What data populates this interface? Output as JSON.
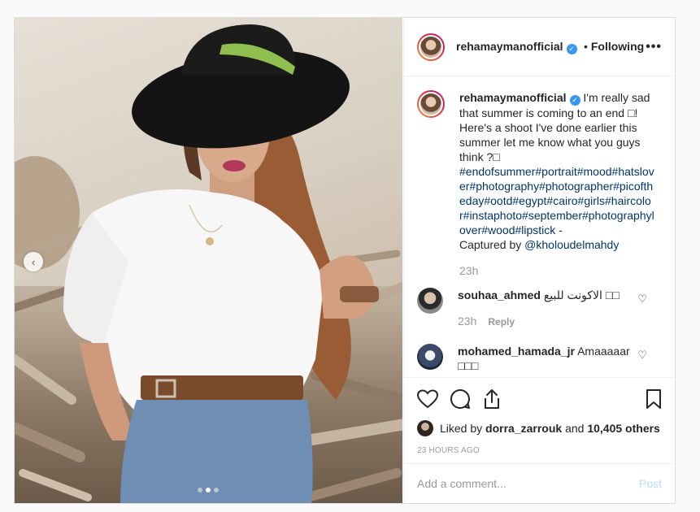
{
  "post": {
    "username": "rehamaymanofficial",
    "verified_mark": "✓",
    "separator": "•",
    "following_label": "Following",
    "more_label": "•••",
    "caption_text": "I'm really sad that summer is coming to an end □! Here's a shoot I've done earlier this summer let me know what you guys think ?□",
    "hashtags": "#endofsummer#portrait#mood#hatslover#photography#photographer#picoftheday#ootd#egypt#cairo#girls#haircolor#instaphoto#september#photographylover#wood#lipstick",
    "hashtag_suffix": " -",
    "credit_prefix": "Captured by ",
    "credit_handle": "@kholoudelmahdy",
    "caption_time": "23h"
  },
  "comments": [
    {
      "username": "souhaa_ahmed",
      "text": "الاكونت للبيع □□",
      "time": "23h",
      "reply_label": "Reply"
    },
    {
      "username": "mohamed_hamada_jr",
      "text": "Amaaaaar □□□"
    }
  ],
  "actions": {
    "liked_by_prefix": "Liked by ",
    "liked_by_user": "dorra_zarrouk",
    "liked_by_join": " and ",
    "likes_count": "10,405 others",
    "time_ago": "23 HOURS AGO"
  },
  "add_comment": {
    "placeholder": "Add a comment...",
    "post_label": "Post"
  },
  "carousel": {
    "prev_label": "‹",
    "slide_count": 3,
    "active_slide": 2
  },
  "icons": [
    "heart-icon",
    "comment-icon",
    "share-icon",
    "bookmark-icon",
    "chevron-left-icon",
    "more-icon"
  ]
}
